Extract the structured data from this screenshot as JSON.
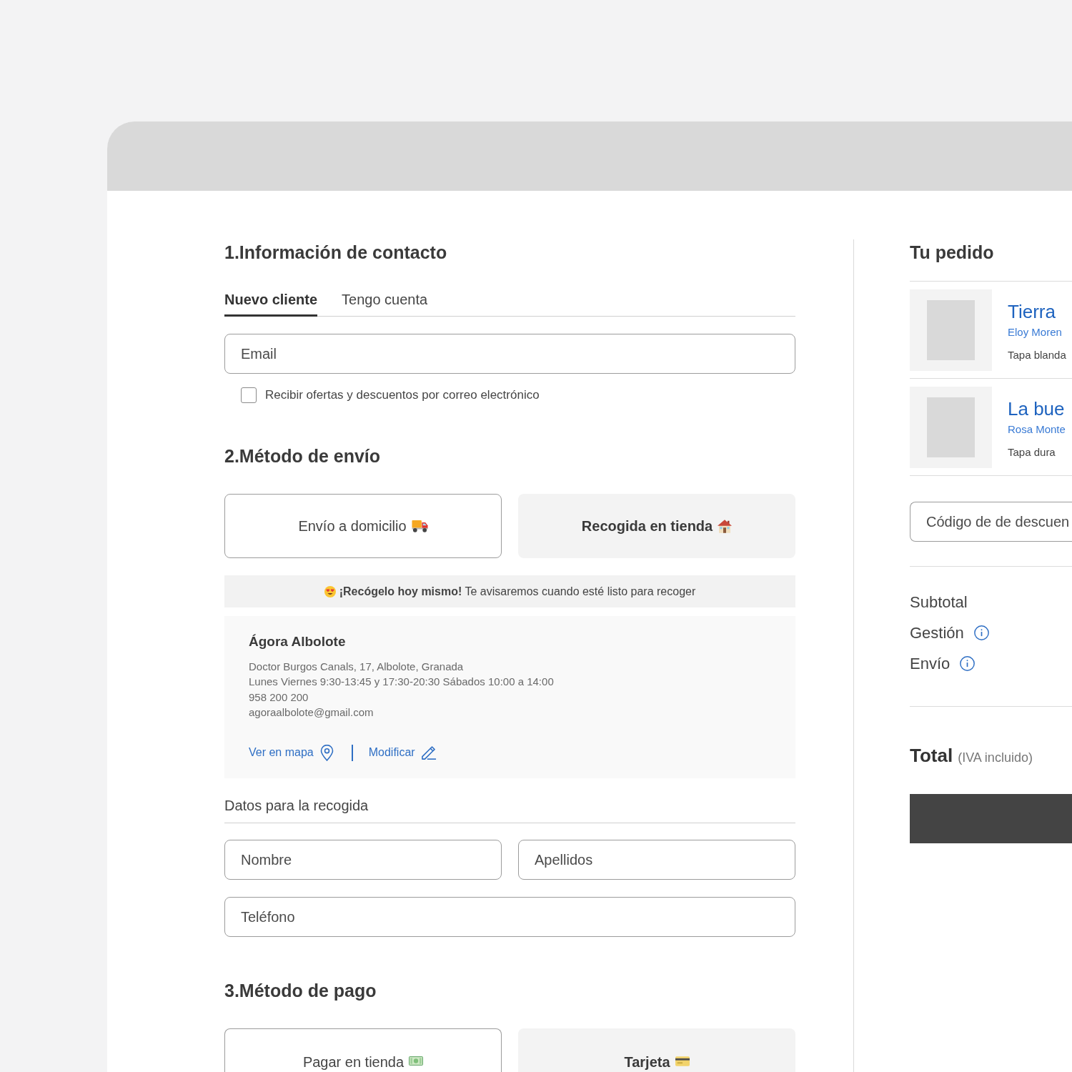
{
  "contact": {
    "title": "1.Información de contacto",
    "tabs": [
      {
        "label": "Nuevo cliente",
        "selected": true
      },
      {
        "label": "Tengo cuenta",
        "selected": false
      }
    ],
    "email": {
      "placeholder": "Email"
    },
    "newsletter": {
      "label": "Recibir ofertas y descuentos por correo electrónico",
      "checked": false
    }
  },
  "shipping": {
    "title": "2.Método de envío",
    "options": [
      {
        "label": "Envío a domicilio",
        "selected": false
      },
      {
        "label": "Recogida en tienda",
        "selected": true
      }
    ],
    "notice": "**¡Recógelo hoy mismo!** Te avisaremos cuando esté listo para recoger",
    "store": {
      "name": "Ágora Albolote",
      "details": [
        "Doctor Burgos Canals, 17, Albolote, Granada",
        "Lunes Viernes 9:30-13:45 y 17:30-20:30 Sábados 10:00 a 14:00",
        "958 200 200",
        "agoraalbolote@gmail.com"
      ],
      "links": [
        "Ver en mapa",
        "Modificar"
      ]
    },
    "pickup_title": "Datos para la recogida",
    "fields": [
      {
        "placeholder": "Nombre"
      },
      {
        "placeholder": "Apellidos"
      },
      {
        "placeholder": "Teléfono"
      }
    ]
  },
  "payment": {
    "title": "3.Método de pago",
    "options": [
      {
        "label": "Pagar en tienda",
        "selected": false
      },
      {
        "label": "Tarjeta",
        "selected": true
      }
    ]
  },
  "order": {
    "title": "Tu pedido",
    "items": [
      {
        "title": "Tierra",
        "author": "Eloy Moren",
        "format": "Tapa blanda"
      },
      {
        "title": "La bue",
        "author": "Rosa Monte",
        "format": "Tapa dura"
      }
    ],
    "discount": {
      "placeholder": "Código de de descuen"
    },
    "summary": [
      {
        "label": "Subtotal",
        "info": false
      },
      {
        "label": "Gestión",
        "info": true
      },
      {
        "label": "Envío",
        "info": true
      }
    ],
    "total": {
      "label": "Total",
      "note": "(IVA incluido)"
    }
  }
}
